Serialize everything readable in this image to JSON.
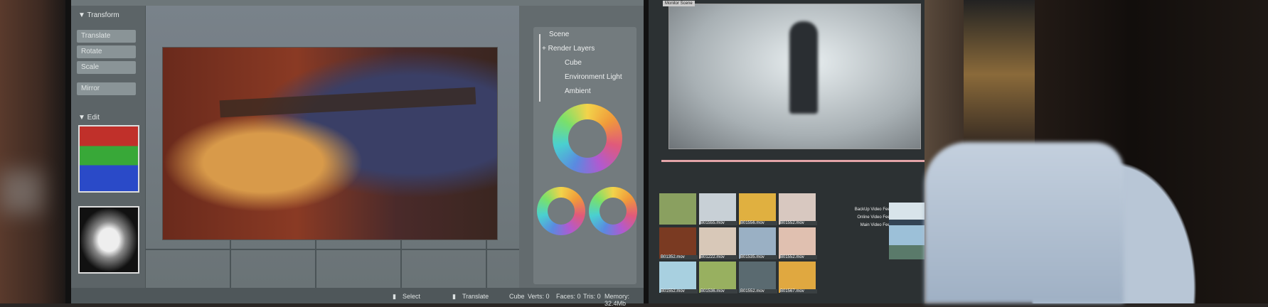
{
  "left_panel": {
    "transform_title": "▼ Transform",
    "buttons": [
      "Translate",
      "Rotate",
      "Scale",
      "Mirror"
    ],
    "edit_title": "▼ Edit"
  },
  "scene_panel": {
    "items": [
      "Scene",
      "+ Render Layers",
      "Cube",
      "Environment Light",
      "Ambient"
    ]
  },
  "status_bar": {
    "select": "Select",
    "translate": "Translate",
    "object": "Cube",
    "verts": "Verts: 0",
    "faces": "Faces: 0",
    "tris": "Tris: 0",
    "memory": "Memory: 32.4Mb"
  },
  "monitor": {
    "title": "Monitor Scene"
  },
  "media": {
    "files": [
      "",
      "B01555.mov",
      "B01556.mov",
      "B01552.mov",
      "B01352.mov",
      "B01222.mov",
      "B01535.mov",
      "B01552.mov",
      "B01552.mov",
      "B01536.mov",
      "B01552.mov",
      "B01567.mov"
    ]
  },
  "timeline": {
    "tracks": [
      "BackUp Video Feed",
      "Online Video Feed",
      "Main Video Feed"
    ]
  }
}
